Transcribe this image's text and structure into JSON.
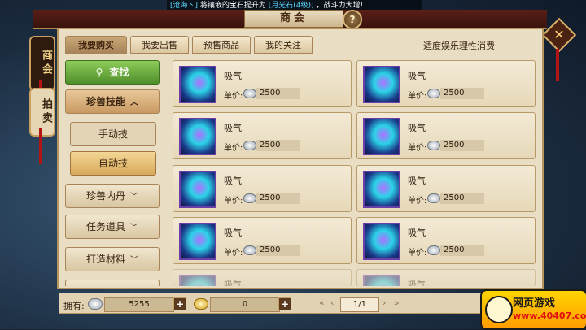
{
  "ticker": {
    "prefix": "[沧海丶]",
    "mid": "将镶嵌的宝石提升为",
    "gem": "[月光石(4级)]",
    "suffix": "，战斗力大增!"
  },
  "window": {
    "title": "商会",
    "help": "?",
    "close": "✕"
  },
  "side_tabs": [
    {
      "label": "商会"
    },
    {
      "label": "拍卖"
    }
  ],
  "tabs": [
    {
      "label": "我要购买",
      "active": true
    },
    {
      "label": "我要出售",
      "active": false
    },
    {
      "label": "预售商品",
      "active": false
    },
    {
      "label": "我的关注",
      "active": false
    }
  ],
  "notice": "适度娱乐理性消费",
  "left_menu": {
    "search": "查找",
    "search_icon": "magnifier-icon",
    "category_open": "珍兽技能",
    "sub_manual": "手动技",
    "sub_auto": "自动技",
    "cat_dan": "珍兽内丹",
    "cat_task": "任务道具",
    "cat_craft": "打造材料",
    "cat_more": ""
  },
  "items": [
    {
      "name": "吸气",
      "price_label": "单价:",
      "price": "2500"
    },
    {
      "name": "吸气",
      "price_label": "单价:",
      "price": "2500"
    },
    {
      "name": "吸气",
      "price_label": "单价:",
      "price": "2500"
    },
    {
      "name": "吸气",
      "price_label": "单价:",
      "price": "2500"
    },
    {
      "name": "吸气",
      "price_label": "单价:",
      "price": "2500"
    },
    {
      "name": "吸气",
      "price_label": "单价:",
      "price": "2500"
    },
    {
      "name": "吸气",
      "price_label": "单价:",
      "price": "2500"
    },
    {
      "name": "吸气",
      "price_label": "单价:",
      "price": "2500"
    },
    {
      "name": "吸气",
      "price_label": "",
      "price": ""
    },
    {
      "name": "吸气",
      "price_label": "",
      "price": ""
    }
  ],
  "bottom": {
    "own_label": "拥有:",
    "silver": "5255",
    "gold": "0",
    "plus": "+",
    "page": "1/1",
    "first": "«",
    "prev": "‹",
    "next": "›",
    "last": "»"
  },
  "logo": {
    "line1": "网页游戏",
    "line2": "www.40407.com"
  }
}
